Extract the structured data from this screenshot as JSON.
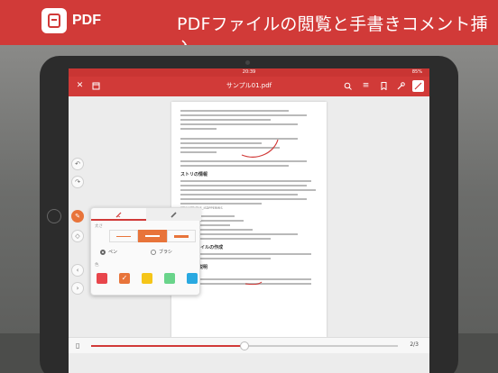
{
  "banner": {
    "logo_text": "PDF",
    "headline": "PDFファイルの閲覧と手書きコメント挿入",
    "color": "#d13a38"
  },
  "status": {
    "time": "20:39",
    "battery": "85%"
  },
  "appbar": {
    "title": "サンプル01.pdf",
    "icons": [
      "close-icon",
      "thumbnail-icon",
      "search-icon",
      "list-icon",
      "bookmark-icon",
      "tools-icon",
      "annotate-icon"
    ]
  },
  "document": {
    "heading_1": "ストリの情報",
    "heading_2": "BLE ファイルの作成",
    "heading_3": "その他の説明",
    "code_line": "KEY_USE_BLE_ISDPPERMIS",
    "menu_label": "メニュー"
  },
  "pen_popup": {
    "tabs": [
      "pen-tab",
      "marker-tab"
    ],
    "thickness_label": "太さ",
    "thickness_options": [
      "thin",
      "medium",
      "thick"
    ],
    "selected_thickness": "medium",
    "type_options": [
      "ペン",
      "ブラシ"
    ],
    "selected_type": "ペン",
    "color_label": "色",
    "colors": [
      "#e8454b",
      "#e8743a",
      "#f5c518",
      "#69d48a",
      "#29a9e1"
    ],
    "selected_color": "#e8743a"
  },
  "bottom": {
    "page_count": "2/3",
    "progress": 0.5
  },
  "accent": "#d13a38"
}
